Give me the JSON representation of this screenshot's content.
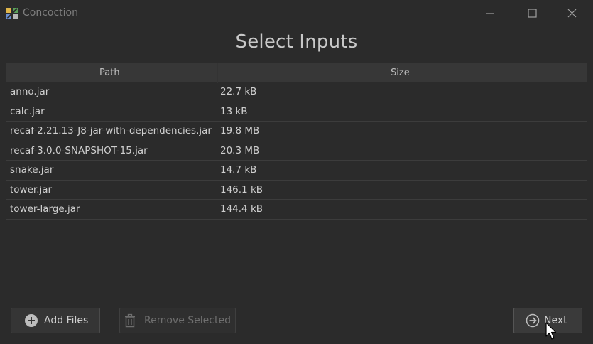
{
  "window": {
    "title": "Concoction"
  },
  "page": {
    "title": "Select Inputs"
  },
  "table": {
    "columns": {
      "path": "Path",
      "size": "Size"
    },
    "rows": [
      {
        "path": "anno.jar",
        "size": "22.7 kB"
      },
      {
        "path": "calc.jar",
        "size": "13 kB"
      },
      {
        "path": "recaf-2.21.13-J8-jar-with-dependencies.jar",
        "size": "19.8 MB"
      },
      {
        "path": "recaf-3.0.0-SNAPSHOT-15.jar",
        "size": "20.3 MB"
      },
      {
        "path": "snake.jar",
        "size": "14.7 kB"
      },
      {
        "path": "tower.jar",
        "size": "146.1 kB"
      },
      {
        "path": "tower-large.jar",
        "size": "144.4 kB"
      }
    ]
  },
  "buttons": {
    "add": {
      "label": "Add Files",
      "icon": "plus-circle-icon"
    },
    "remove": {
      "label": "Remove Selected",
      "icon": "trash-icon",
      "enabled": false
    },
    "next": {
      "label": "Next",
      "icon": "arrow-right-circle-icon"
    }
  },
  "colors": {
    "background": "#2b2b2b",
    "header": "#373737",
    "text": "#cfcfcf",
    "disabled_text": "#6f6f6f"
  }
}
